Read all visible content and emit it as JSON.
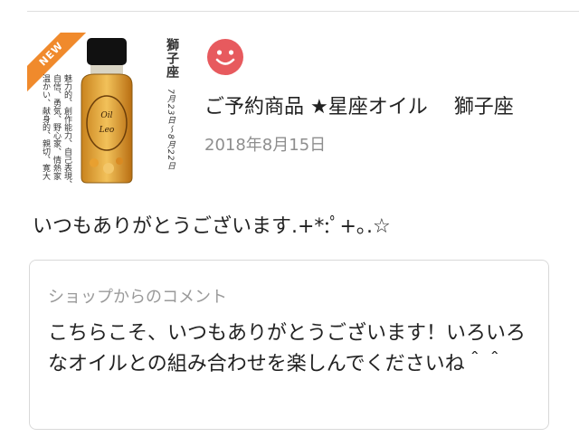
{
  "product": {
    "badge": "NEW",
    "sign_name": "獅子座",
    "sign_dates": "7月23日〜8月22日",
    "traits": [
      "魅力的、創作能力、自己表現、",
      "自信、勇気、野心家、情熱家",
      "温かい、献身的、親切、寛大"
    ],
    "bottle_label_top": "Oil",
    "bottle_label_bottom": "Leo"
  },
  "item": {
    "title": "ご予約商品 ★星座オイル　 獅子座",
    "date": "2018年8月15日",
    "avatar_icon": "smiley-face-icon",
    "avatar_color": "#e75a5e"
  },
  "review": {
    "comment": "いつもありがとうございます.+*:ﾟ+｡.☆"
  },
  "shop": {
    "label": "ショップからのコメント",
    "reply": "こちらこそ、いつもありがとうございます！いろいろなオイルとの組み合わせを楽しんでくださいね＾＾"
  }
}
